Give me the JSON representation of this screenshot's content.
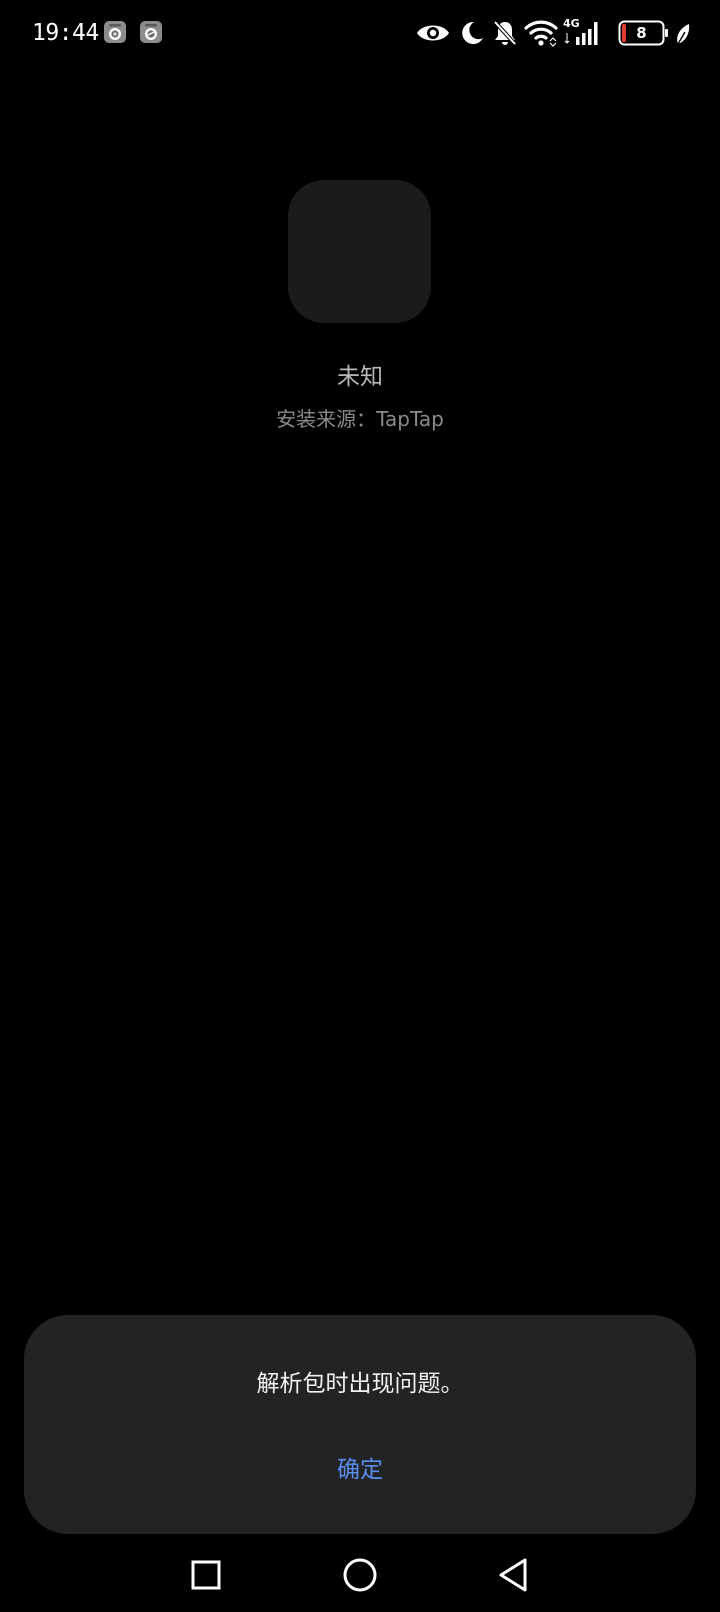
{
  "status_bar": {
    "time": "19:44",
    "notification_icons": [
      "camera-app-icon",
      "camera-app-icon"
    ],
    "system_icons": [
      "eye-icon",
      "moon-icon",
      "bell-off-icon",
      "wifi-icon",
      "cellular-4g-icon",
      "battery-icon",
      "leaf-icon"
    ],
    "network_type": "4G",
    "battery_level": "8",
    "battery_low_color": "#e53935"
  },
  "app": {
    "name": "未知",
    "install_source": "安装来源：TapTap"
  },
  "dialog": {
    "message": "解析包时出现问题。",
    "confirm_label": "确定",
    "accent_color": "#5b8def"
  },
  "nav_bar": {
    "buttons": [
      "recents-square-icon",
      "home-circle-icon",
      "back-triangle-icon"
    ]
  }
}
